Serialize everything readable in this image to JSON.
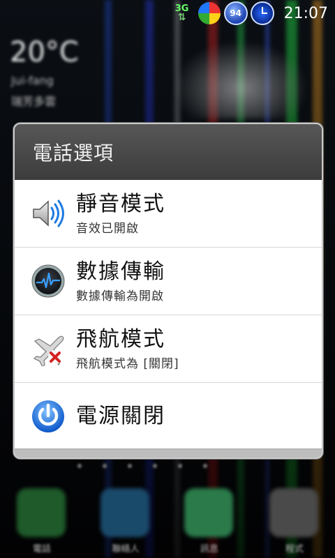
{
  "statusbar": {
    "network": "3G",
    "badge": "94",
    "time": "21:07"
  },
  "dialog": {
    "title": "電話選項",
    "items": [
      {
        "title": "靜音模式",
        "subtitle": "音效已開啟",
        "icon": "speaker-icon"
      },
      {
        "title": "數據傳輸",
        "subtitle": "數據傳輸為開啟",
        "icon": "data-transfer-icon"
      },
      {
        "title": "飛航模式",
        "subtitle": "飛航模式為 [關閉]",
        "icon": "airplane-off-icon"
      },
      {
        "title": "電源關閉",
        "icon": "power-icon"
      }
    ]
  },
  "background": {
    "weather_temp": "20°C",
    "weather_city": "Jui-fang",
    "weather_desc": "瑞芳多雲",
    "dock": [
      "電話",
      "聯絡人",
      "訊息",
      "程式"
    ]
  },
  "colors": {
    "header_bg": "#4a4a4a",
    "accent_blue": "#1e7ae0"
  }
}
